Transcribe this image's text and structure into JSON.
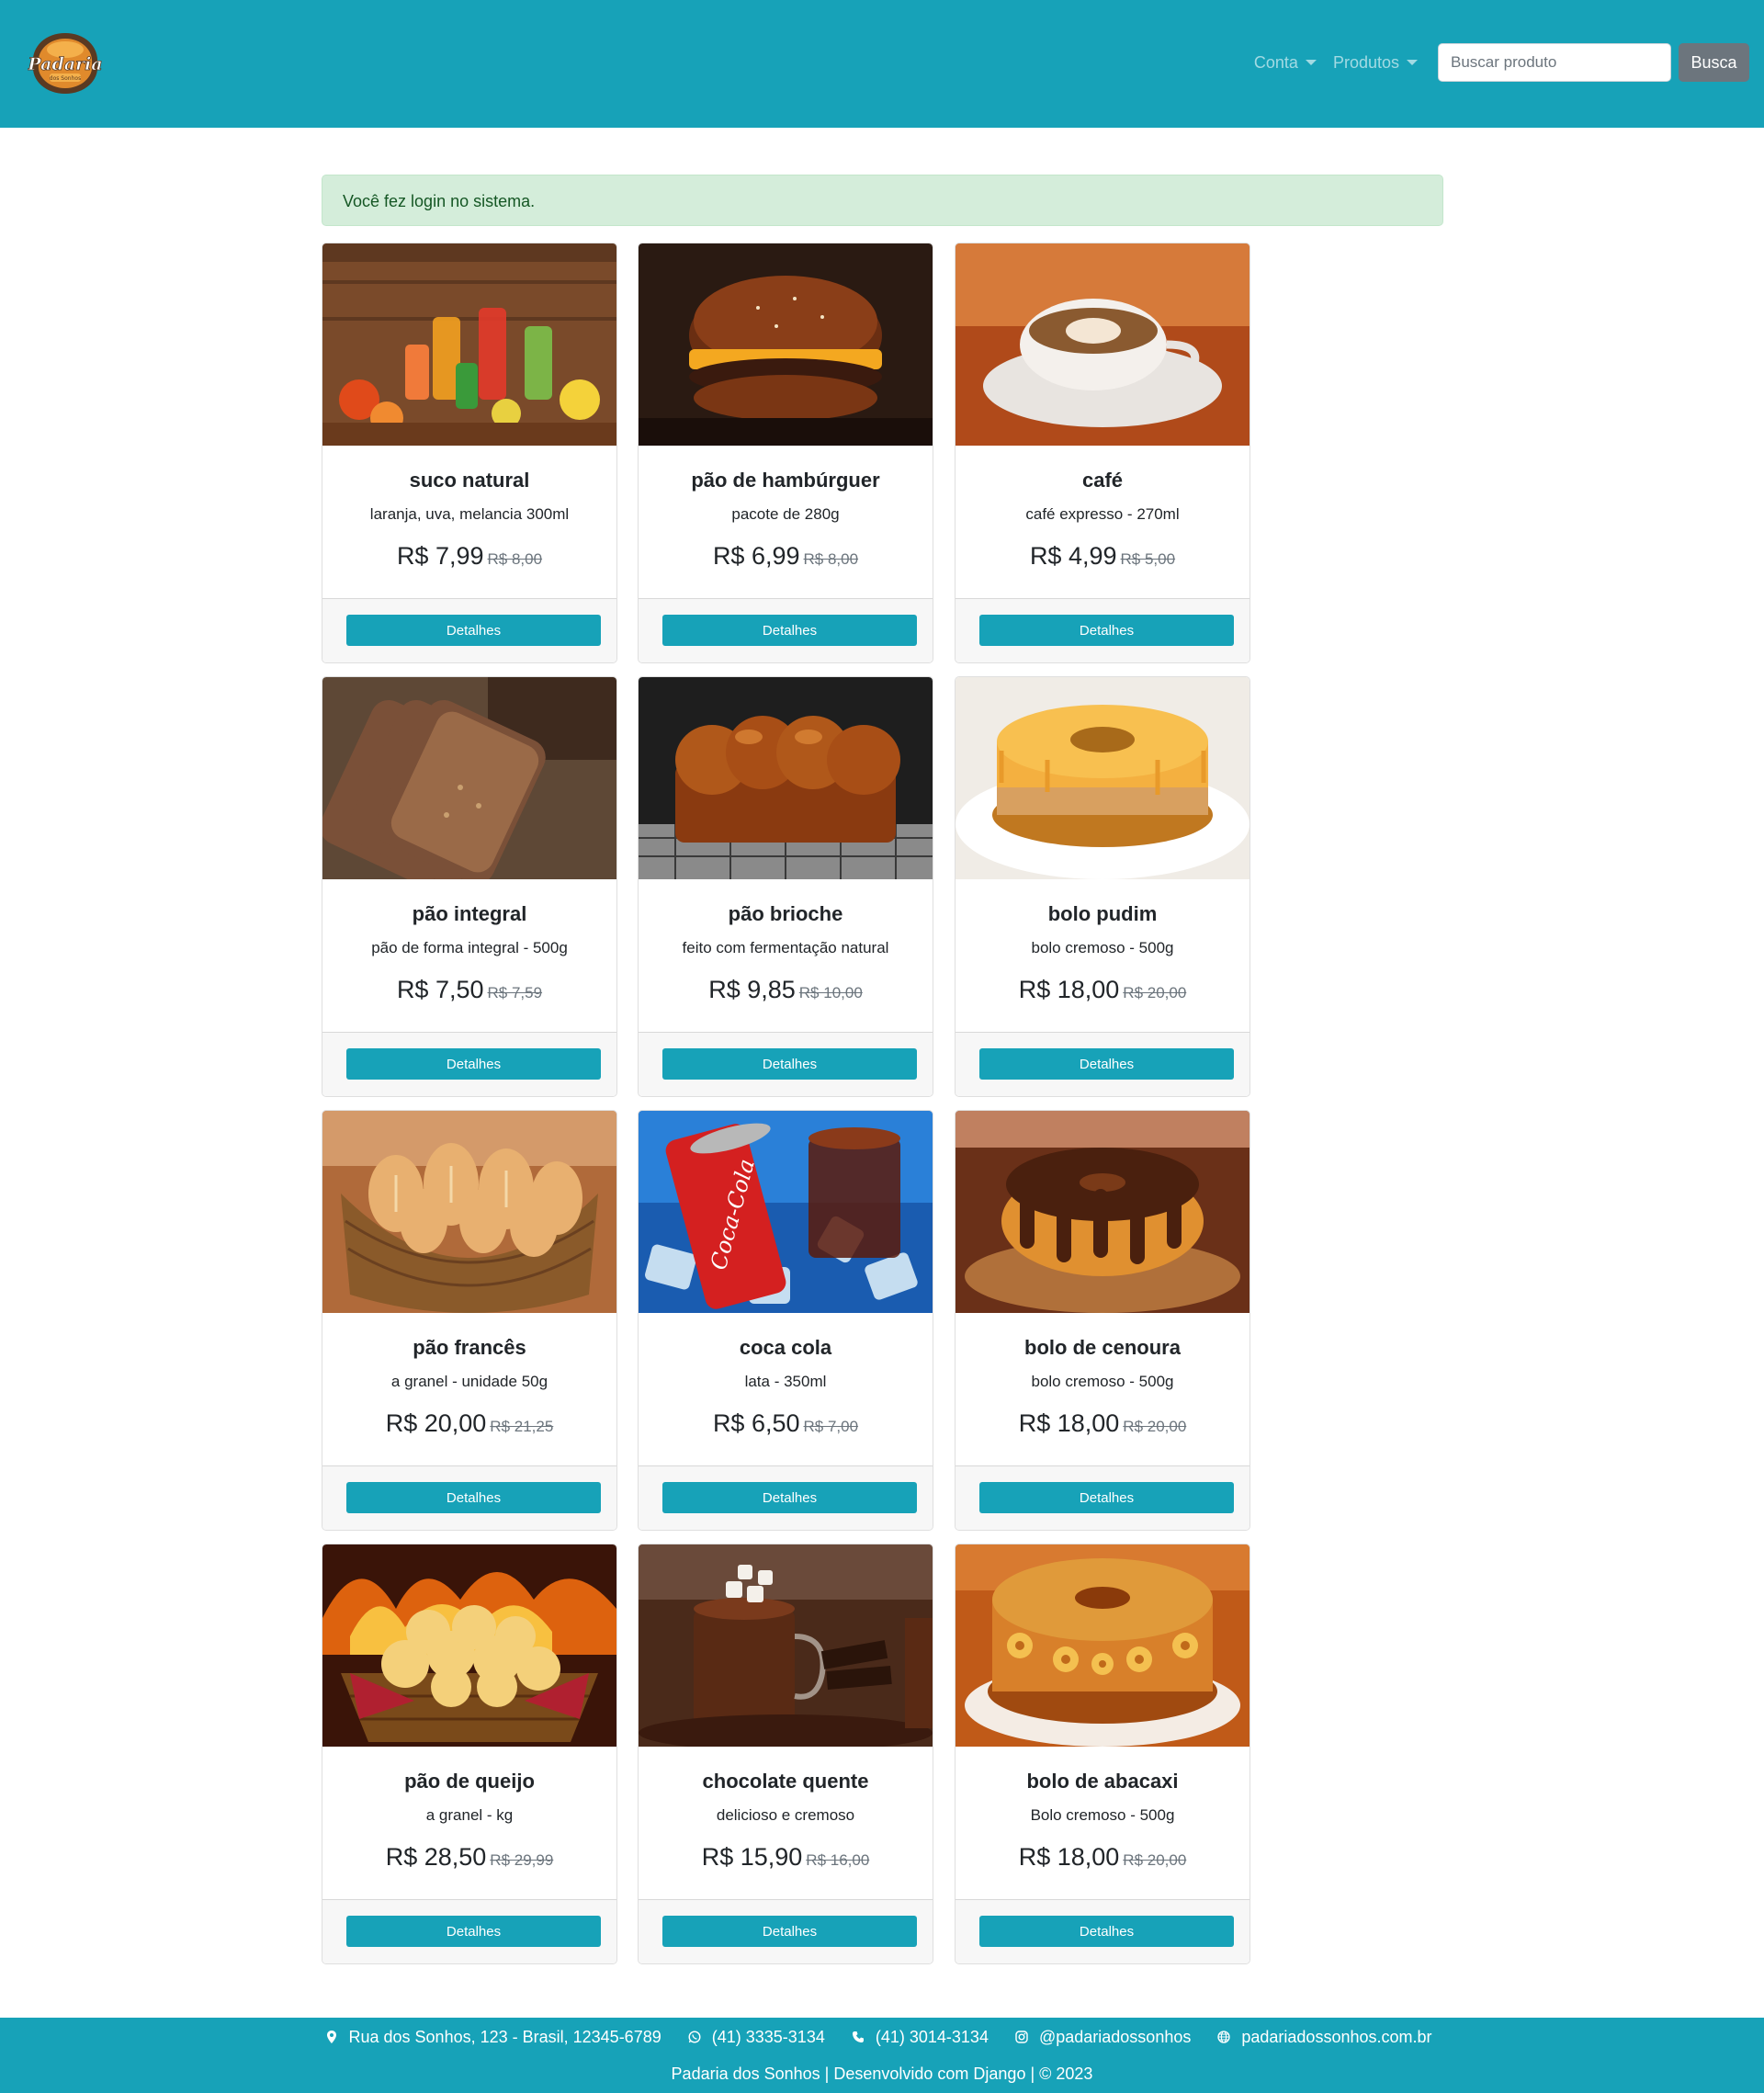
{
  "brand": {
    "logo_text": "Padaria",
    "logo_subtext": "dos Sonhos"
  },
  "nav": {
    "account_label": "Conta",
    "products_label": "Produtos",
    "search_placeholder": "Buscar produto",
    "search_button": "Busca"
  },
  "alert": {
    "message": "Você fez login no sistema."
  },
  "products": [
    {
      "name": "suco natural",
      "description": "laranja, uva, melancia 300ml",
      "price": "R$ 7,99",
      "old_price": "R$ 8,00",
      "button": "Detalhes",
      "image": "juice-glasses-photo"
    },
    {
      "name": "pão de hambúrguer",
      "description": "pacote de 280g",
      "price": "R$ 6,99",
      "old_price": "R$ 8,00",
      "button": "Detalhes",
      "image": "hamburger-photo"
    },
    {
      "name": "café",
      "description": "café expresso - 270ml",
      "price": "R$ 4,99",
      "old_price": "R$ 5,00",
      "button": "Detalhes",
      "image": "coffee-cup-photo"
    },
    {
      "name": "pão integral",
      "description": "pão de forma integral - 500g",
      "price": "R$ 7,50",
      "old_price": "R$ 7,59",
      "button": "Detalhes",
      "image": "whole-bread-photo"
    },
    {
      "name": "pão brioche",
      "description": "feito com fermentação natural",
      "price": "R$ 9,85",
      "old_price": "R$ 10,00",
      "button": "Detalhes",
      "image": "brioche-photo"
    },
    {
      "name": "bolo pudim",
      "description": "bolo cremoso - 500g",
      "price": "R$ 18,00",
      "old_price": "R$ 20,00",
      "button": "Detalhes",
      "image": "pudding-cake-photo"
    },
    {
      "name": "pão francês",
      "description": "a granel - unidade 50g",
      "price": "R$ 20,00",
      "old_price": "R$ 21,25",
      "button": "Detalhes",
      "image": "french-bread-basket-photo"
    },
    {
      "name": "coca cola",
      "description": "lata - 350ml",
      "price": "R$ 6,50",
      "old_price": "R$ 7,00",
      "button": "Detalhes",
      "image": "cola-can-photo"
    },
    {
      "name": "bolo de cenoura",
      "description": "bolo cremoso - 500g",
      "price": "R$ 18,00",
      "old_price": "R$ 20,00",
      "button": "Detalhes",
      "image": "carrot-cake-photo"
    },
    {
      "name": "pão de queijo",
      "description": "a granel - kg",
      "price": "R$ 28,50",
      "old_price": "R$ 29,99",
      "button": "Detalhes",
      "image": "cheese-bread-basket-photo"
    },
    {
      "name": "chocolate quente",
      "description": "delicioso e cremoso",
      "price": "R$ 15,90",
      "old_price": "R$ 16,00",
      "button": "Detalhes",
      "image": "hot-chocolate-photo"
    },
    {
      "name": "bolo de abacaxi",
      "description": "Bolo cremoso - 500g",
      "price": "R$ 18,00",
      "old_price": "R$ 20,00",
      "button": "Detalhes",
      "image": "pineapple-cake-photo"
    }
  ],
  "footer": {
    "address": "Rua dos Sonhos, 123 - Brasil, 12345-6789",
    "whatsapp": "(41) 3335-3134",
    "phone": "(41) 3014-3134",
    "instagram": "@padariadossonhos",
    "website": "padariadossonhos.com.br",
    "copyright": "Padaria dos Sonhos | Desenvolvido com Django | © 2023"
  },
  "colors": {
    "primary": "#17a2b8",
    "alert_bg": "#d4edda",
    "alert_text": "#155724",
    "secondary": "#6c757d"
  }
}
